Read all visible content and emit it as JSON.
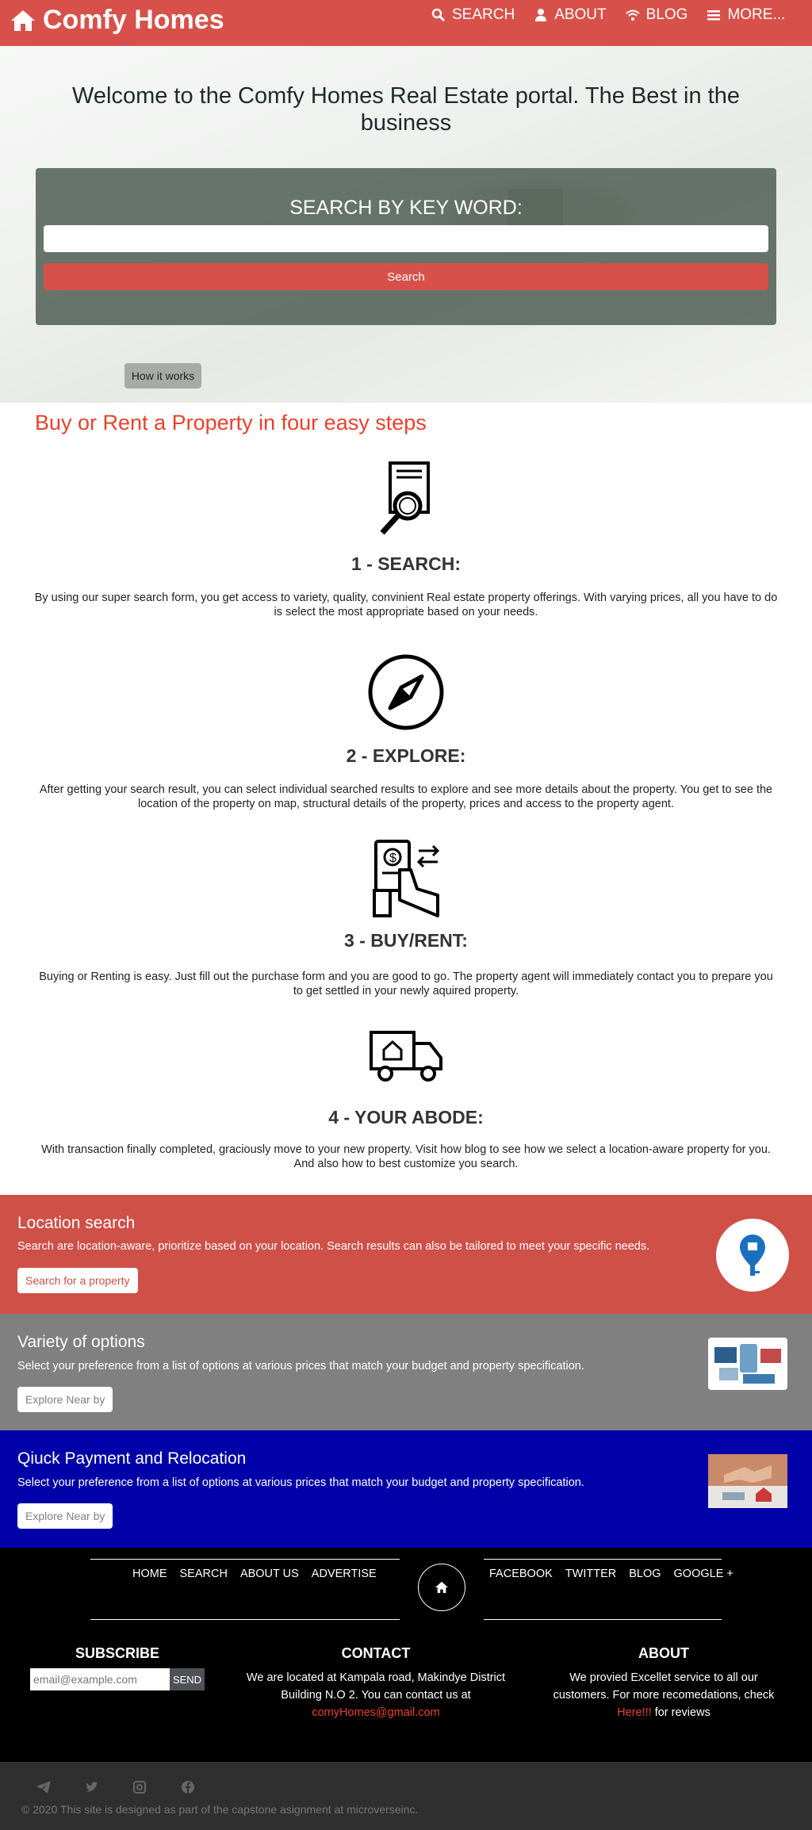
{
  "nav": {
    "brand": "Comfy Homes",
    "items": [
      {
        "label": "SEARCH",
        "icon": "search-icon"
      },
      {
        "label": "ABOUT",
        "icon": "user-icon"
      },
      {
        "label": "BLOG",
        "icon": "wifi-icon"
      },
      {
        "label": "MORE...",
        "icon": "menu-icon"
      }
    ]
  },
  "hero": {
    "title": "Welcome to the Comfy Homes Real Estate portal. The Best in the business",
    "search_title": "SEARCH BY KEY WORD:",
    "search_placeholder": "",
    "search_button": "Search",
    "how_button": "How it works"
  },
  "steps": {
    "heading": "Buy or Rent a Property in four easy steps",
    "items": [
      {
        "title": "1 - SEARCH:",
        "icon": "document-search-icon",
        "text": "By using our super search form, you get access to variety, quality, convinient Real estate property offerings. With varying prices, all you have to do is select the most appropriate based on your needs."
      },
      {
        "title": "2 - EXPLORE:",
        "icon": "compass-icon",
        "text": "After getting your search result, you can select individual searched results to explore and see more details about the property. You get to see the location of the property on map, structural details of the property, prices and access to the property agent."
      },
      {
        "title": "3 - BUY/RENT:",
        "icon": "payment-hand-icon",
        "text": "Buying or Renting is easy. Just fill out the purchase form and you are good to go. The property agent will immediately contact you to prepare you to get settled in your newly aquired property."
      },
      {
        "title": "4 - YOUR ABODE:",
        "icon": "moving-truck-icon",
        "text": "With transaction finally completed, graciously move to your new property. Visit how blog to see how we select a location-aware property for you. And also how to best customize you search."
      }
    ]
  },
  "features": [
    {
      "title": "Location search",
      "text": "Search are location-aware, prioritize based on your location. Search results can also be tailored to meet your specific needs.",
      "button": "Search for a property",
      "color": "#cf5047"
    },
    {
      "title": "Variety of options",
      "text": "Select your preference from a list of options at various prices that match your budget and property specification.",
      "button": "Explore Near by",
      "color": "#808080"
    },
    {
      "title": "Qiuck Payment and Relocation",
      "text": "Select your preference from a list of options at various prices that match your budget and property specification.",
      "button": "Explore Near by",
      "color": "#0000a8"
    }
  ],
  "footer": {
    "left_links": [
      "HOME",
      "SEARCH",
      "ABOUT US",
      "ADVERTISE"
    ],
    "right_links": [
      "FACEBOOK",
      "TWITTER",
      "BLOG",
      "GOOGLE +"
    ],
    "subscribe_title": "SUBSCRIBE",
    "email_placeholder": "email@example.com",
    "send_label": "SEND",
    "contact_title": "CONTACT",
    "contact_text": "We are located at Kampala road, Makindye District Building N.O 2. You can contact us at",
    "contact_email": "comyHomes@gmail.com",
    "about_title": "ABOUT",
    "about_text": "We provied Excellet service to all our customers. For more recomedations, check",
    "about_link": "Here!!!",
    "about_suffix": "for reviews"
  },
  "bottom": {
    "copyright": "© 2020 This site is designed as part of the capstone asignment at microverseinc."
  }
}
